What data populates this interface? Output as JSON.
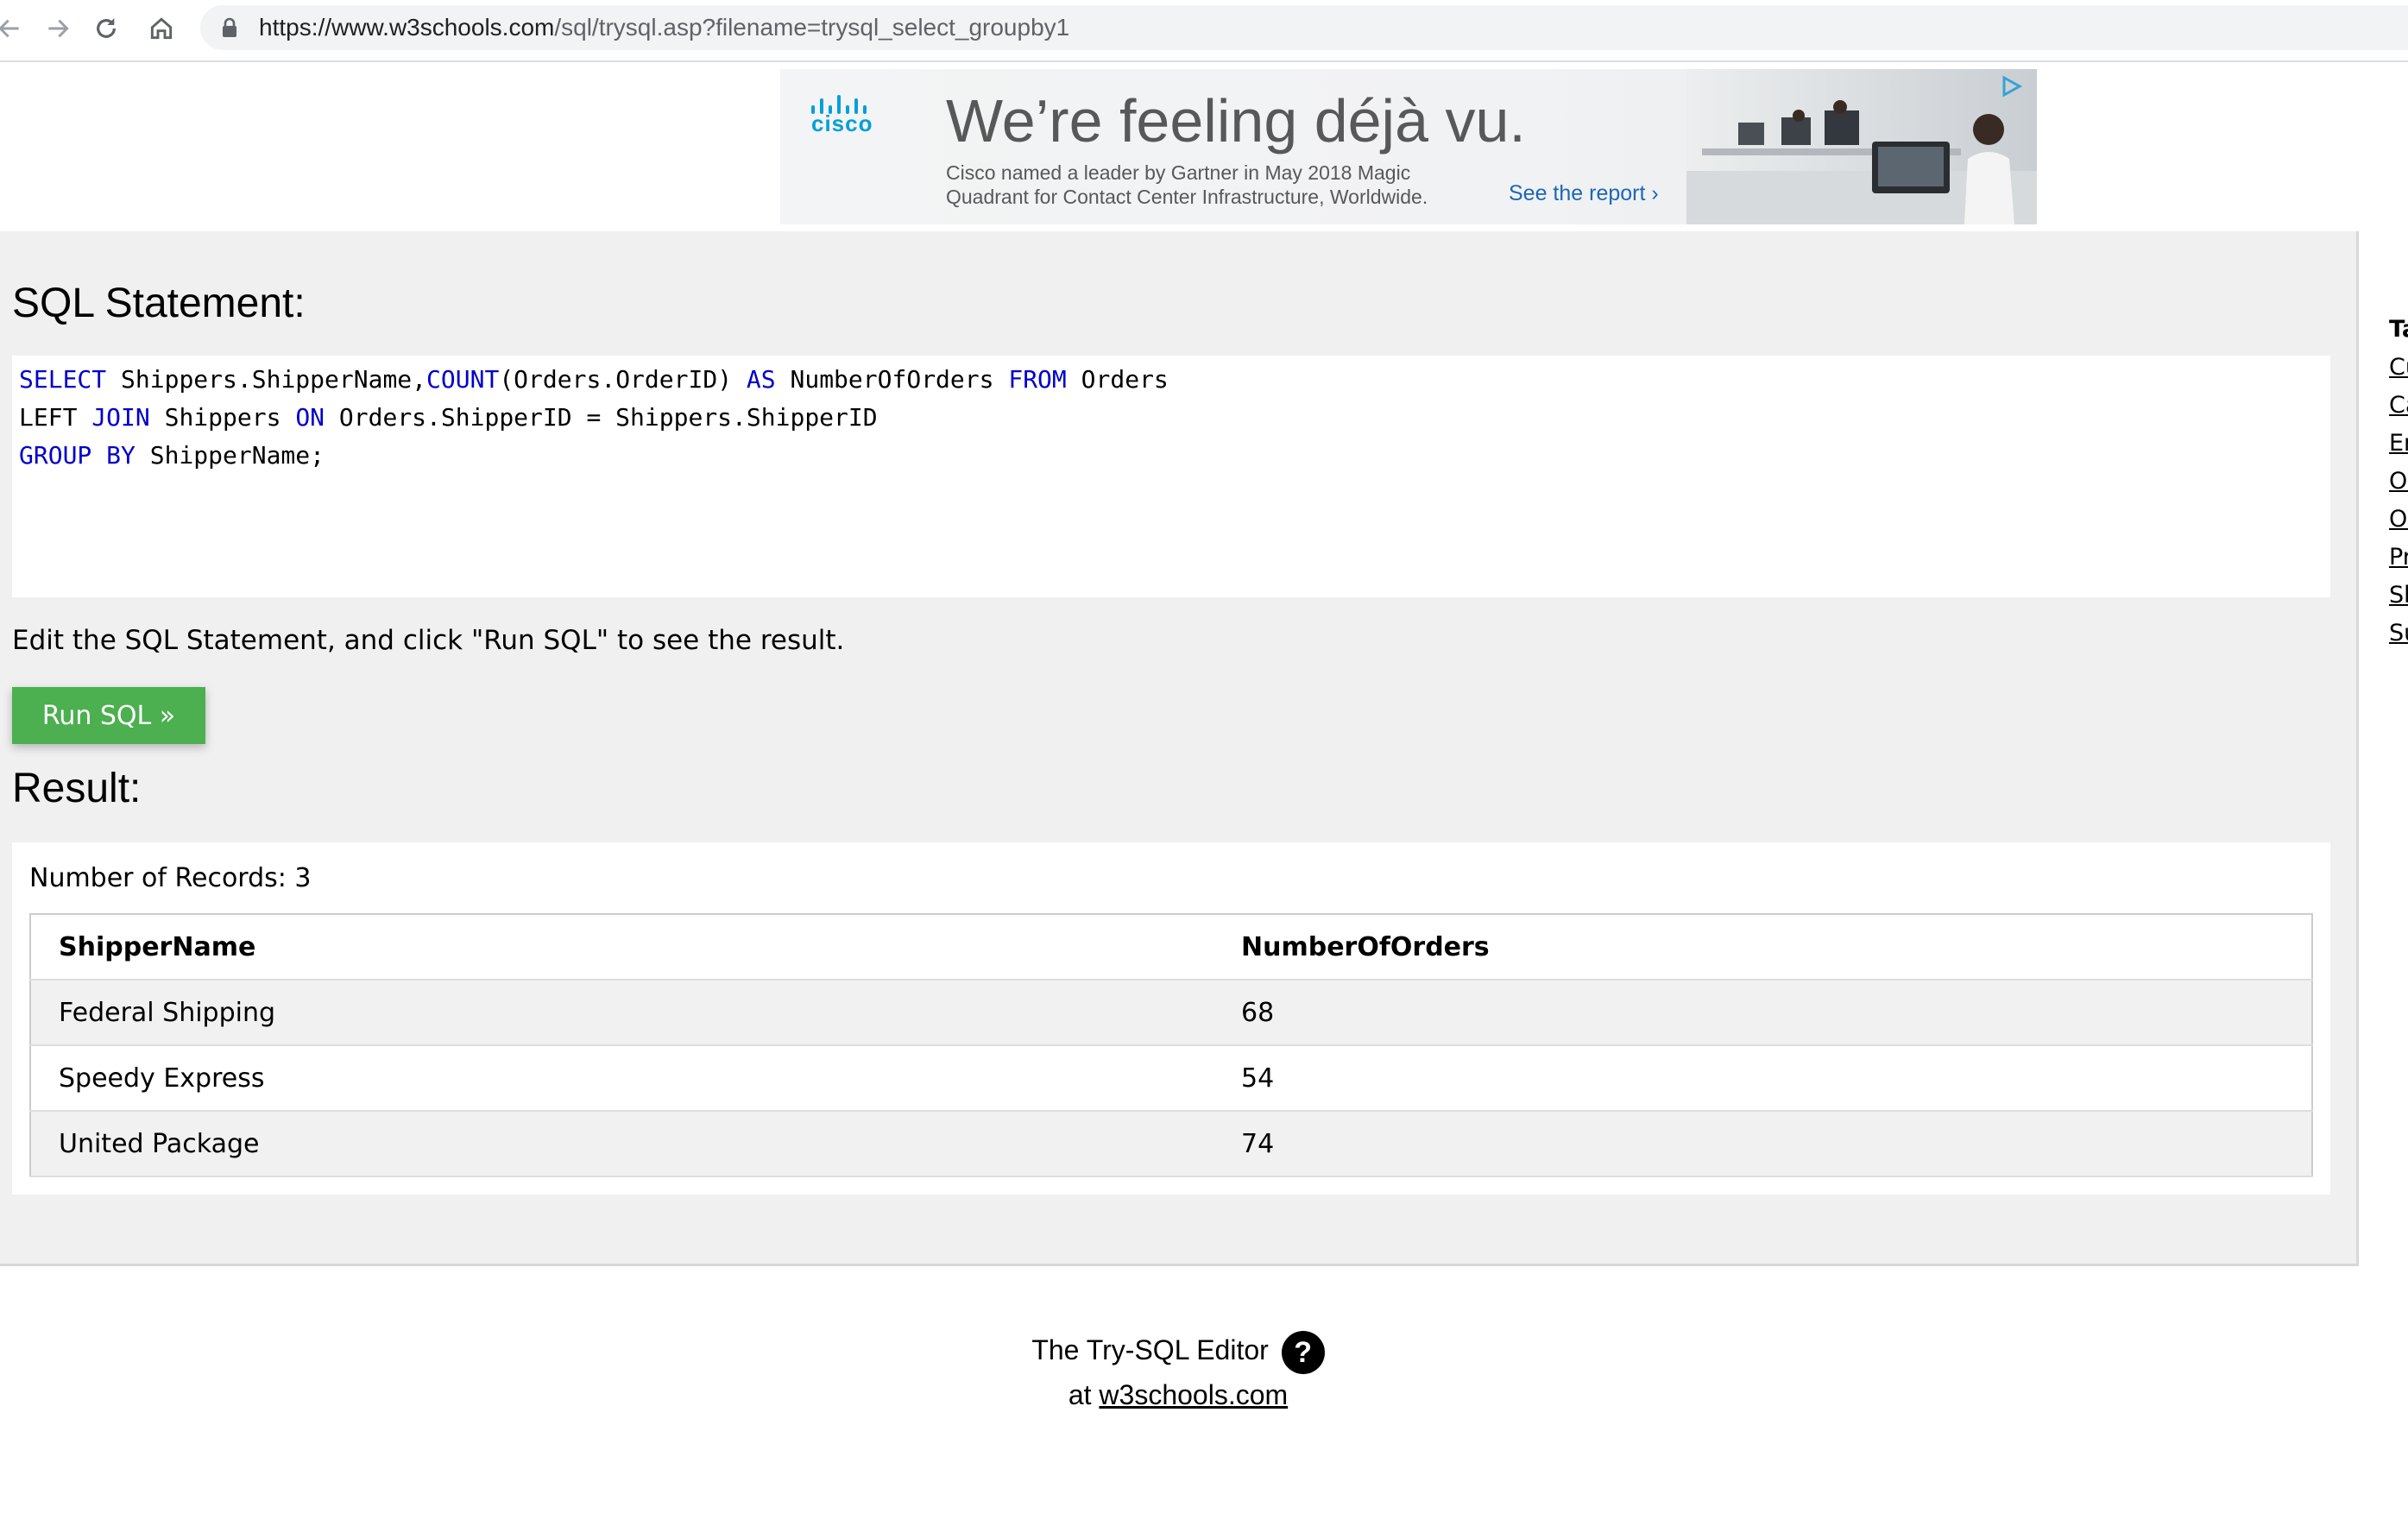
{
  "browser": {
    "url_host": "https://www.w3schools.com",
    "url_path": "/sql/trysql.asp?filename=trysql_select_groupby1"
  },
  "ad": {
    "brand": "cisco",
    "headline": "We’re feeling déjà vu.",
    "body": "Cisco named a leader by Gartner in May 2018 Magic Quadrant for Contact Center Infrastructure, Worldwide.",
    "link": "See the report ›"
  },
  "editor": {
    "statement_heading": "SQL Statement:",
    "code_lines": [
      [
        {
          "t": "SELECT",
          "k": true
        },
        {
          "t": " Shippers.ShipperName,",
          "k": false
        },
        {
          "t": "COUNT",
          "k": true
        },
        {
          "t": "(Orders.OrderID) ",
          "k": false
        },
        {
          "t": "AS",
          "k": true
        },
        {
          "t": " NumberOfOrders ",
          "k": false
        },
        {
          "t": "FROM",
          "k": true
        },
        {
          "t": " Orders",
          "k": false
        }
      ],
      [
        {
          "t": "LEFT ",
          "k": false
        },
        {
          "t": "JOIN",
          "k": true
        },
        {
          "t": " Shippers ",
          "k": false
        },
        {
          "t": "ON",
          "k": true
        },
        {
          "t": " Orders.ShipperID = Shippers.ShipperID",
          "k": false
        }
      ],
      [
        {
          "t": "GROUP BY",
          "k": true
        },
        {
          "t": " ShipperName;",
          "k": false
        }
      ]
    ],
    "hint": "Edit the SQL Statement, and click \"Run SQL\" to see the result.",
    "run_button": "Run SQL »"
  },
  "result": {
    "heading": "Result:",
    "record_count": "Number of Records: 3",
    "columns": [
      "ShipperName",
      "NumberOfOrders"
    ],
    "rows": [
      [
        "Federal Shipping",
        "68"
      ],
      [
        "Speedy Express",
        "54"
      ],
      [
        "United Package",
        "74"
      ]
    ]
  },
  "sidebar": {
    "heading": "Ta",
    "links": [
      "Cu",
      "Ca",
      "Em",
      "Or",
      "Or",
      "Pr",
      "Sh",
      "Su"
    ]
  },
  "footer": {
    "line1": "The Try-SQL Editor",
    "help": "?",
    "at": "at ",
    "link": "w3schools.com"
  }
}
